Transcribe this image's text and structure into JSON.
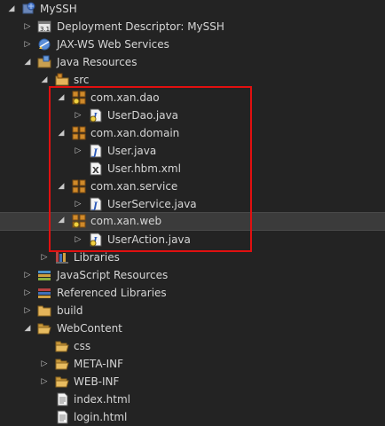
{
  "tree": {
    "project": "MySSH",
    "items": {
      "deployment": "Deployment Descriptor: MySSH",
      "jaxws": "JAX-WS Web Services",
      "java_resources": "Java Resources",
      "src": "src",
      "pkg_dao": "com.xan.dao",
      "userdao": "UserDao.java",
      "pkg_domain": "com.xan.domain",
      "user_java": "User.java",
      "user_hbm": "User.hbm.xml",
      "pkg_service": "com.xan.service",
      "userservice": "UserService.java",
      "pkg_web": "com.xan.web",
      "useraction": "UserAction.java",
      "libraries": "Libraries",
      "js_resources": "JavaScript Resources",
      "ref_libraries": "Referenced Libraries",
      "build": "build",
      "webcontent": "WebContent",
      "css": "css",
      "metainf": "META-INF",
      "webinf": "WEB-INF",
      "index": "index.html",
      "login": "login.html"
    },
    "selected_item": "com.xan.web"
  },
  "colors": {
    "background": "#232323",
    "text": "#d6d6d6",
    "highlight_box": "#e11010",
    "package_icon": "#d08a2a",
    "folder_icon": "#e4b45a"
  }
}
